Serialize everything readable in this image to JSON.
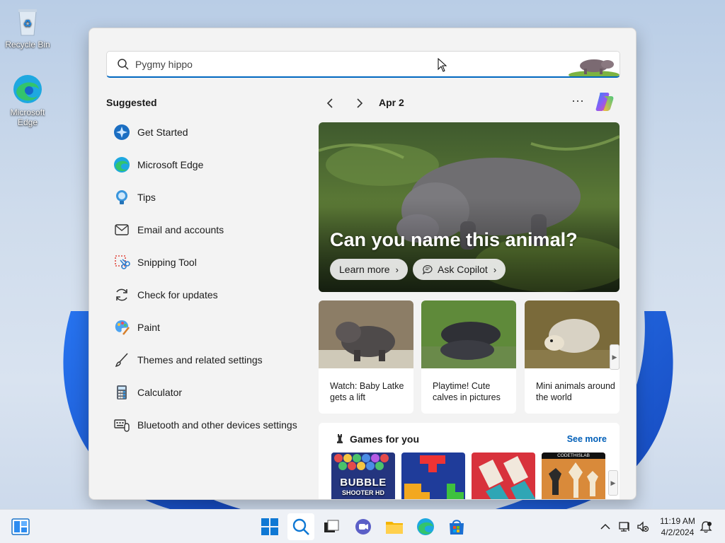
{
  "desktop": {
    "icons": [
      {
        "label": "Recycle Bin"
      },
      {
        "label": "Microsoft Edge"
      }
    ]
  },
  "search": {
    "value": "Pygmy hippo",
    "placeholder": "Search"
  },
  "suggested": {
    "title": "Suggested",
    "items": [
      {
        "label": "Get Started",
        "icon": "get-started-icon"
      },
      {
        "label": "Microsoft Edge",
        "icon": "edge-icon"
      },
      {
        "label": "Tips",
        "icon": "tips-icon"
      },
      {
        "label": "Email and accounts",
        "icon": "mail-icon"
      },
      {
        "label": "Snipping Tool",
        "icon": "snipping-tool-icon"
      },
      {
        "label": "Check for updates",
        "icon": "refresh-icon"
      },
      {
        "label": "Paint",
        "icon": "paint-icon"
      },
      {
        "label": "Themes and related settings",
        "icon": "brush-icon"
      },
      {
        "label": "Calculator",
        "icon": "calculator-icon"
      },
      {
        "label": "Bluetooth and other devices settings",
        "icon": "devices-icon"
      }
    ]
  },
  "highlights": {
    "date": "Apr 2",
    "more": "···",
    "hero": {
      "title": "Can you name this animal?",
      "learn_more": "Learn more",
      "ask_copilot": "Ask Copilot"
    },
    "cards": [
      {
        "caption": "Watch: Baby Latke gets a lift"
      },
      {
        "caption": "Playtime! Cute calves in pictures"
      },
      {
        "caption": "Mini animals around the world"
      }
    ],
    "games": {
      "title": "Games for you",
      "see_more": "See more",
      "tiles": [
        {
          "name": "BUBBLE",
          "sub": "SHOOTER HD"
        },
        {
          "name": ""
        },
        {
          "name": ""
        },
        {
          "name": "CODETHISLAB"
        }
      ]
    }
  },
  "taskbar": {
    "time": "11:19 AM",
    "date": "4/2/2024"
  },
  "colors": {
    "accent": "#0067c0",
    "link": "#005fb8",
    "panel_bg": "#f3f3f3"
  }
}
